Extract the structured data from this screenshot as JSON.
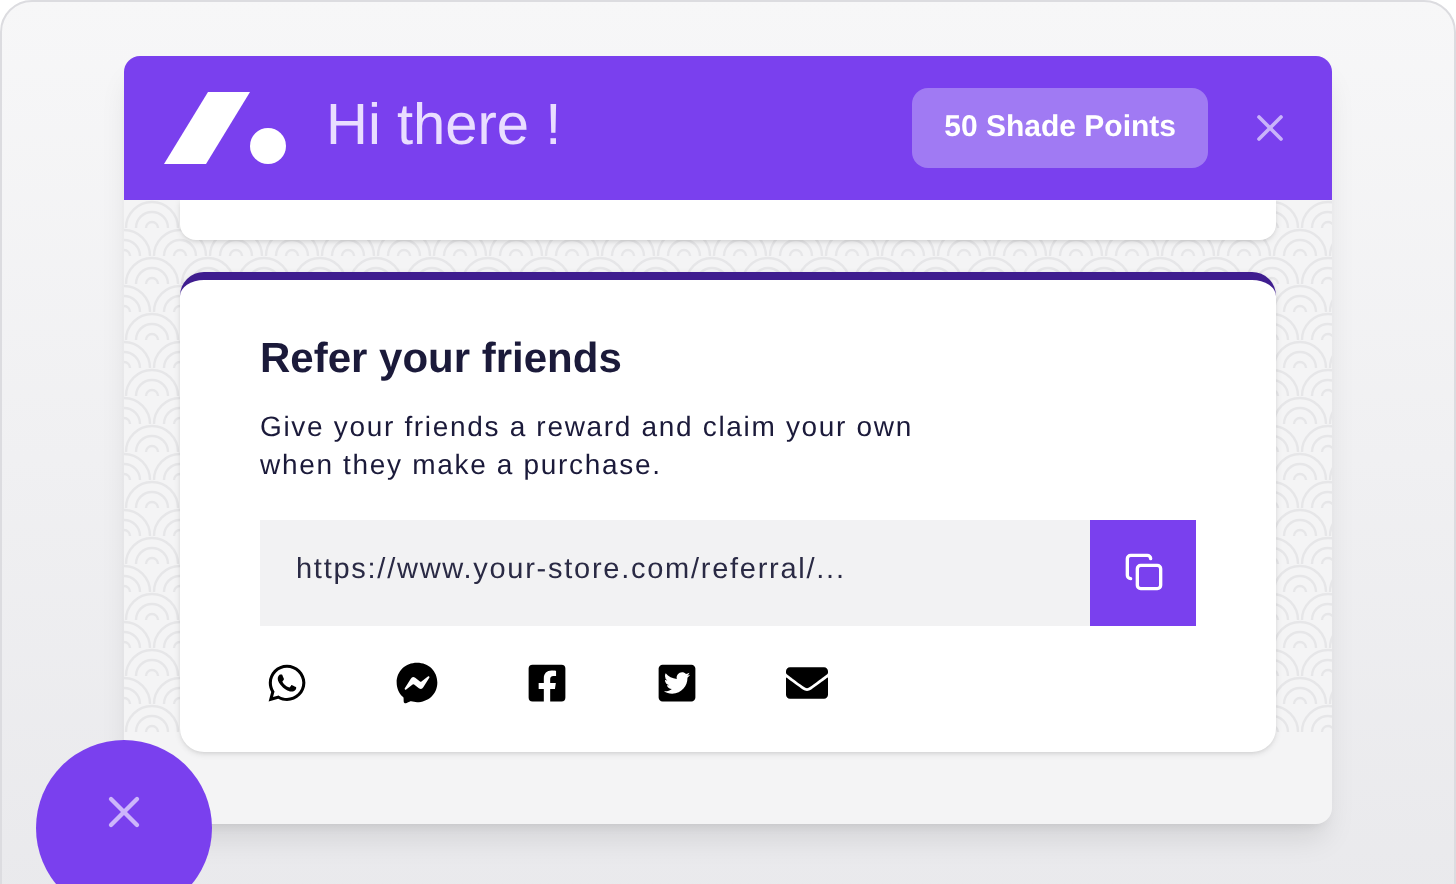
{
  "header": {
    "title": "Hi there !",
    "points_badge": "50 Shade Points"
  },
  "referral_card": {
    "title": "Refer your friends",
    "description": "Give your friends a reward and claim your own when they make a purchase.",
    "link": "https://www.your-store.com/referral/..."
  },
  "share": [
    {
      "kind": "whatsapp"
    },
    {
      "kind": "messenger"
    },
    {
      "kind": "facebook"
    },
    {
      "kind": "twitter"
    },
    {
      "kind": "email"
    }
  ]
}
